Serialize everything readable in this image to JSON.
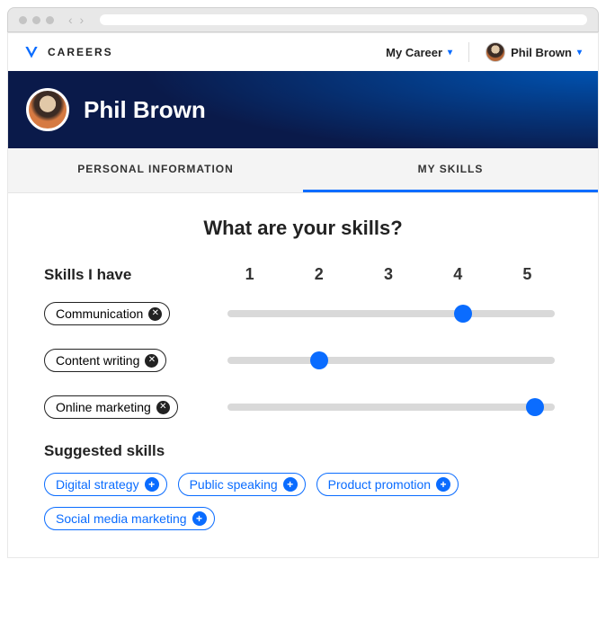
{
  "brand": {
    "label": "CAREERS"
  },
  "topnav": {
    "my_career_label": "My Career",
    "user_name": "Phil Brown"
  },
  "hero": {
    "name": "Phil Brown"
  },
  "tabs": {
    "personal": "PERSONAL INFORMATION",
    "skills": "MY SKILLS",
    "active": "skills"
  },
  "headline": "What are your skills?",
  "skills_section": {
    "label": "Skills I have",
    "scale": [
      "1",
      "2",
      "3",
      "4",
      "5"
    ],
    "rows": [
      {
        "name": "Communication",
        "value": 4,
        "max": 5
      },
      {
        "name": "Content writing",
        "value": 2,
        "max": 5
      },
      {
        "name": "Online marketing",
        "value": 5,
        "max": 5
      }
    ]
  },
  "suggested": {
    "label": "Suggested skills",
    "items": [
      "Digital strategy",
      "Public speaking",
      "Product promotion",
      "Social media marketing"
    ]
  }
}
